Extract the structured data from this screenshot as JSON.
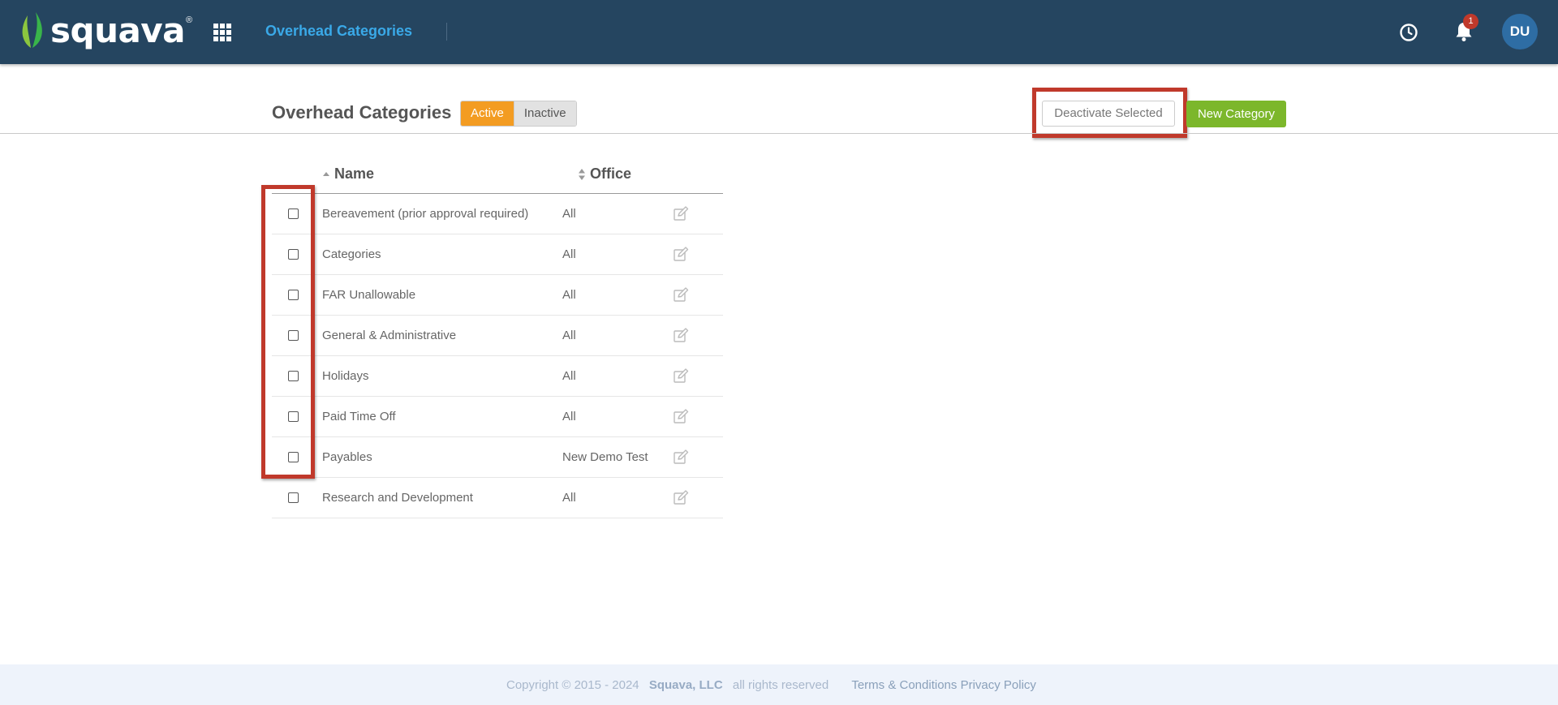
{
  "app": {
    "brand": "squava",
    "brand_mark": "®",
    "section_title": "Overhead Categories"
  },
  "header": {
    "notification_count": "1",
    "avatar_initials": "DU"
  },
  "page": {
    "title": "Overhead Categories",
    "toggle_active": "Active",
    "toggle_inactive": "Inactive",
    "deactivate_label": "Deactivate Selected",
    "new_label": "New Category"
  },
  "table": {
    "col_name": "Name",
    "col_office": "Office",
    "rows": [
      {
        "name": "Bereavement (prior approval required)",
        "office": "All"
      },
      {
        "name": "Categories",
        "office": "All"
      },
      {
        "name": "FAR Unallowable",
        "office": "All"
      },
      {
        "name": "General & Administrative",
        "office": "All"
      },
      {
        "name": "Holidays",
        "office": "All"
      },
      {
        "name": "Paid Time Off",
        "office": "All"
      },
      {
        "name": "Payables",
        "office": "New Demo Test"
      },
      {
        "name": "Research and Development",
        "office": "All"
      }
    ]
  },
  "footer": {
    "copyright": "Copyright © 2015 - 2024",
    "company": "Squava, LLC",
    "rights": "all rights reserved",
    "terms": "Terms & Conditions",
    "privacy": "Privacy Policy"
  },
  "colors": {
    "topbar": "#254560",
    "accent_blue": "#3aa9e8",
    "active_orange": "#f39c22",
    "new_green": "#7cb72b",
    "highlight_red": "#c0392b"
  },
  "icons": [
    "leaf-logo-icon",
    "apps-grid-icon",
    "clock-icon",
    "bell-icon",
    "sort-asc-icon",
    "sort-both-icon",
    "edit-icon"
  ]
}
